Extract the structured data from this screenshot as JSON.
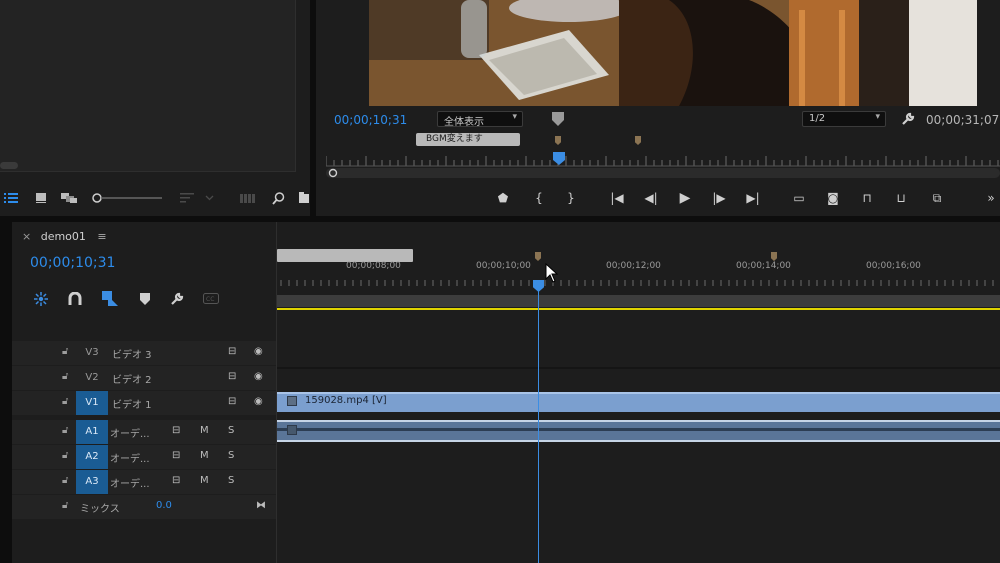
{
  "program_monitor": {
    "playhead_tc": "00;00;10;31",
    "fit_label": "全体表示",
    "resolution": "1/2",
    "duration_tc": "00;00;31;07",
    "marker_label": "BGM変えます"
  },
  "timeline": {
    "sequence_name": "demo01",
    "current_tc": "00;00;10;31",
    "ruler_labels": [
      "00;00;08;00",
      "00;00;10;00",
      "00;00;12;00",
      "00;00;14;00",
      "00;00;16;00"
    ],
    "tracks": [
      {
        "id": "V3",
        "name": "ビデオ 3",
        "targeted": false
      },
      {
        "id": "V2",
        "name": "ビデオ 2",
        "targeted": false
      },
      {
        "id": "V1",
        "name": "ビデオ 1",
        "targeted": true
      },
      {
        "id": "A1",
        "name": "オーデ...",
        "targeted": true
      },
      {
        "id": "A2",
        "name": "オーデ...",
        "targeted": true
      },
      {
        "id": "A3",
        "name": "オーデ...",
        "targeted": true
      }
    ],
    "mix_label": "ミックス",
    "mix_value": "0.0",
    "clip_label": "159028.mp4 [V]",
    "mute_label": "M",
    "solo_label": "S"
  },
  "colors": {
    "timecode": "#2d8ceb",
    "playhead": "#3b8de3",
    "video_clip": "#7b9fcf",
    "audio_clip": "#5a7598",
    "work_area": "#e0d400",
    "marker": "#8b7453"
  }
}
